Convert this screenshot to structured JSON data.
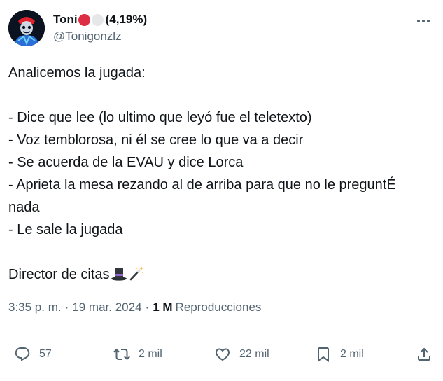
{
  "user": {
    "display_name": "Toni",
    "name_emojis": [
      "red-circle",
      "white-circle"
    ],
    "percent_label": "(4,19%)",
    "handle": "@Tonigonzlz"
  },
  "tweet": {
    "lines": [
      "Analicemos la jugada:",
      "- Dice que lee (lo ultimo que leyó fue el teletexto)",
      "- Voz temblorosa, ni él se cree lo que va a decir",
      "- Se acuerda de la EVAU y dice Lorca",
      "- Aprieta la mesa rezando al de arriba para que no le preguntÉ nada",
      "- Le sale la jugada",
      "Director de citas"
    ],
    "closing_emojis": [
      "top-hat",
      "magic-wand"
    ]
  },
  "meta": {
    "time": "3:35 p. m.",
    "separator": "·",
    "date": "19 mar. 2024",
    "views_count": "1 M",
    "views_label": "Reproducciones"
  },
  "actions": {
    "replies": "57",
    "retweets": "2 mil",
    "likes": "22 mil",
    "bookmarks": "2 mil"
  },
  "colors": {
    "text_primary": "#0f1419",
    "text_secondary": "#536471",
    "divider": "#eff3f4",
    "red_circle": "#dd2e44"
  }
}
